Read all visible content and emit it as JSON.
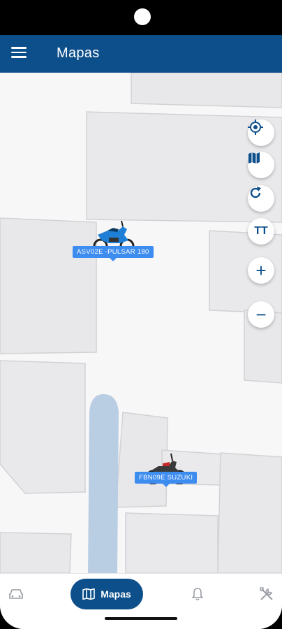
{
  "app_bar": {
    "title": "Mapas",
    "menu_icon": "hamburger-menu-icon"
  },
  "map_controls": [
    {
      "name": "locate-button",
      "icon": "target-crosshair-icon"
    },
    {
      "name": "map-type-button",
      "icon": "folded-map-icon"
    },
    {
      "name": "refresh-button",
      "icon": "refresh-icon"
    },
    {
      "name": "text-size-button",
      "icon": "text-size-icon",
      "label": "TT"
    },
    {
      "name": "zoom-in-button",
      "icon": "plus-icon",
      "label": "+"
    },
    {
      "name": "zoom-out-button",
      "icon": "minus-icon",
      "label": "−"
    }
  ],
  "vehicles": [
    {
      "label": "ASV02E -PULSAR 180",
      "icon": "motorcycle-blue-icon"
    },
    {
      "label": "FBN09E SUZUKI",
      "icon": "motorcycle-red-icon"
    }
  ],
  "bottom_nav": {
    "items": [
      {
        "name": "vehicles",
        "icon": "car-icon"
      },
      {
        "name": "maps",
        "icon": "map-icon",
        "label": "Mapas",
        "active": true
      },
      {
        "name": "alerts",
        "icon": "bell-icon"
      },
      {
        "name": "tools",
        "icon": "tools-icon"
      }
    ]
  },
  "colors": {
    "primary": "#0d4f8b",
    "label_bg": "#3d8cf0",
    "road": "#b9cde3"
  }
}
